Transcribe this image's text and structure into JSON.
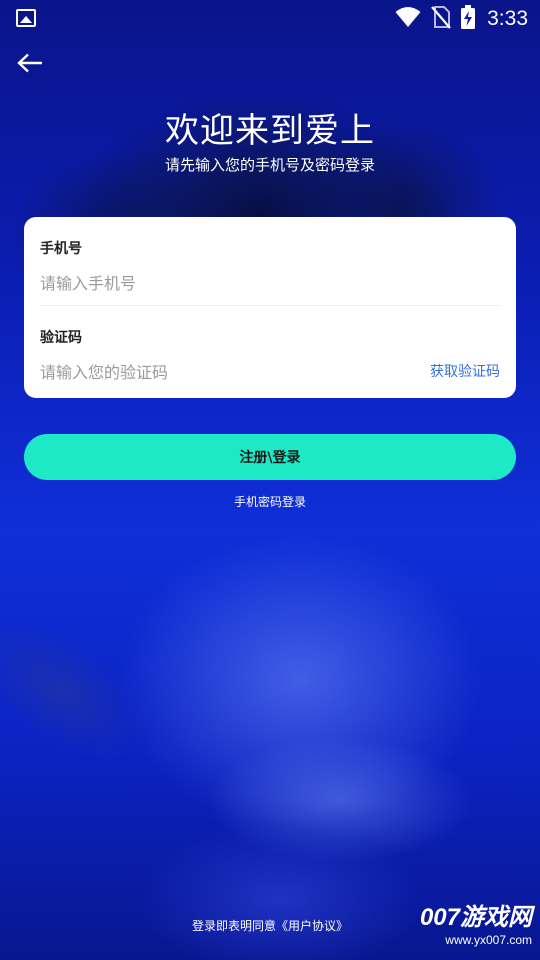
{
  "status_bar": {
    "time": "3:33",
    "icons": [
      "gallery-icon",
      "wifi-icon",
      "no-sim-icon",
      "battery-charging-icon"
    ]
  },
  "header": {
    "back_icon": "back-arrow-icon",
    "title": "欢迎来到爱上",
    "subtitle": "请先输入您的手机号及密码登录"
  },
  "form": {
    "phone": {
      "label": "手机号",
      "placeholder": "请输入手机号",
      "value": ""
    },
    "code": {
      "label": "验证码",
      "placeholder": "请输入您的验证码",
      "value": "",
      "get_code_label": "获取验证码"
    }
  },
  "actions": {
    "login_label": "注册\\登录",
    "password_login_label": "手机密码登录"
  },
  "footer": {
    "agreement_prefix": "登录即表明同意",
    "agreement_link": "《用户协议》"
  },
  "watermark": {
    "brand": "007游戏网",
    "url": "www.yx007.com"
  },
  "colors": {
    "accent": "#1de9c6",
    "link": "#2f6fe0",
    "background": "#0b1eb4"
  }
}
